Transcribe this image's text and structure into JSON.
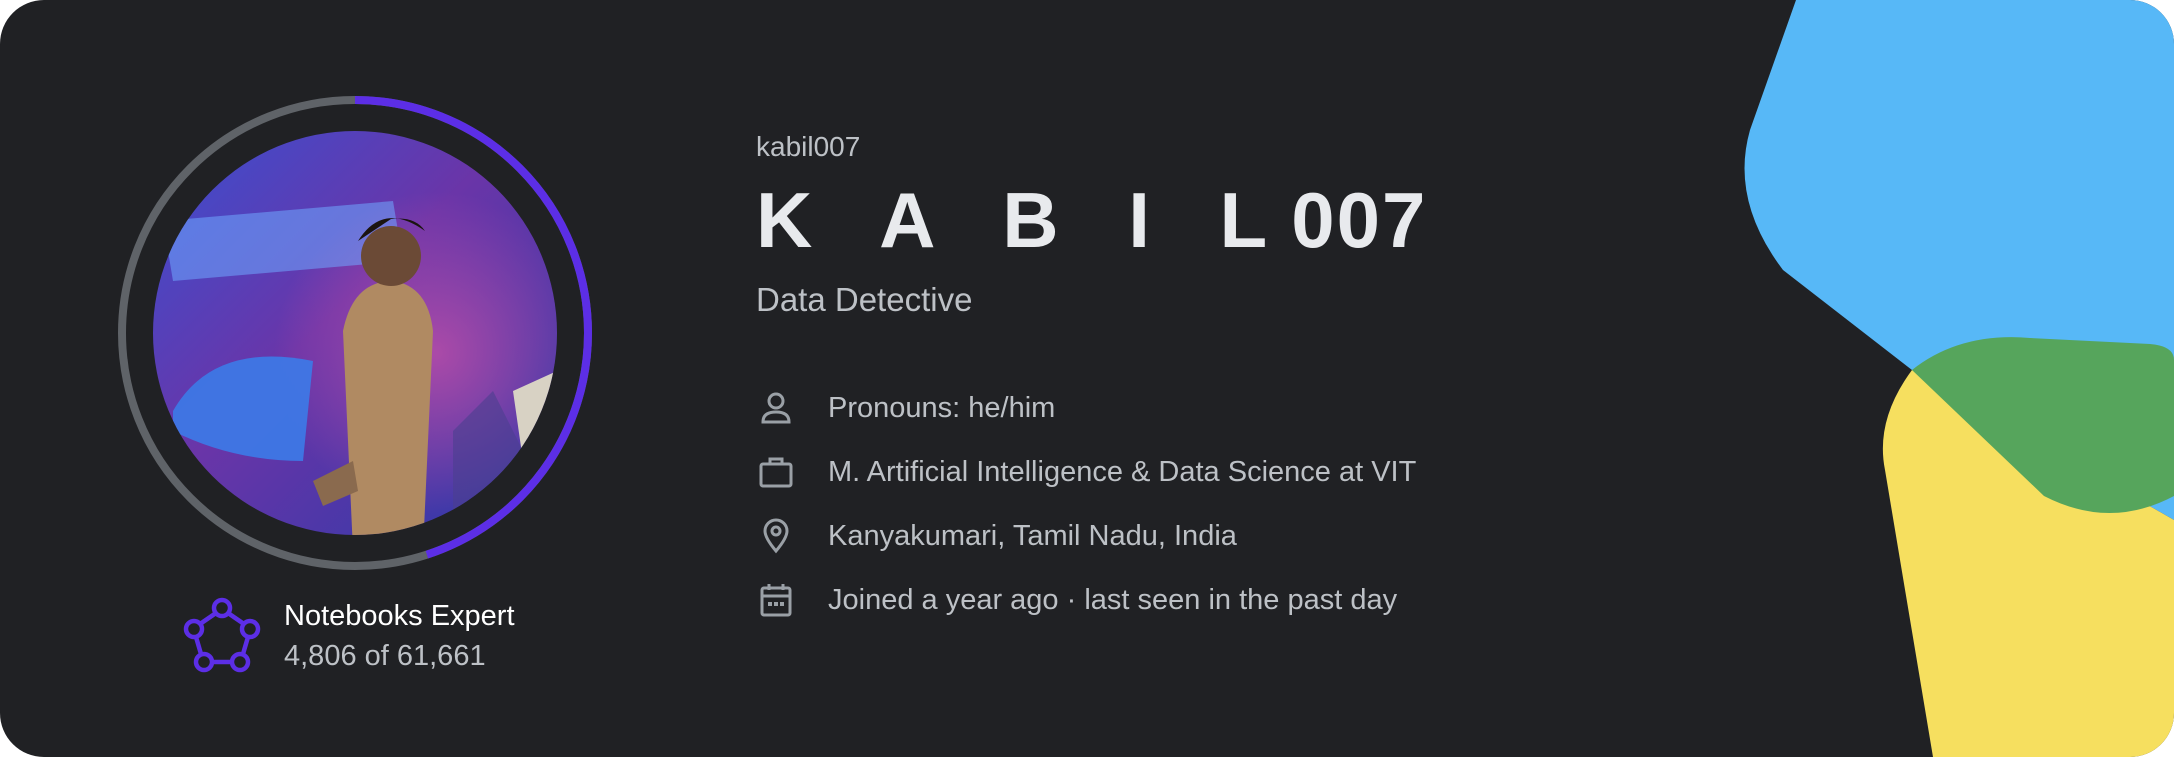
{
  "profile": {
    "username": "kabil007",
    "display_name_letters": "K A B I L",
    "display_name_digits": "007",
    "tagline": "Data Detective"
  },
  "details": [
    {
      "icon": "person-icon",
      "text": "Pronouns: he/him"
    },
    {
      "icon": "briefcase-icon",
      "text": "M. Artificial Intelligence & Data Science at VIT"
    },
    {
      "icon": "location-pin-icon",
      "text": "Kanyakumari, Tamil Nadu, India"
    },
    {
      "icon": "calendar-icon",
      "text": "Joined a year ago · last seen in the past day"
    }
  ],
  "tier": {
    "icon": "pentagon-network-icon",
    "name": "Notebooks Expert",
    "rank_text": "4,806 of 61,661",
    "progress_fraction": 0.45
  },
  "colors": {
    "card_background": "#202124",
    "progress_accent": "#5c2ee6",
    "ring_track": "#5f6368",
    "decor_blue": "#57b8f7",
    "decor_green": "#56a55c",
    "decor_yellow": "#f6df5f"
  }
}
